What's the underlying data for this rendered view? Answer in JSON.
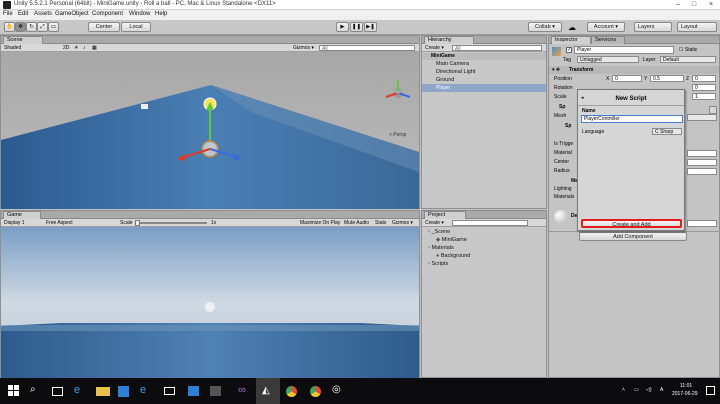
{
  "window": {
    "title": "Unity 5.5.2.1 Personal (64bit) - MiniGame.unity - Roll a ball - PC, Mac & Linux Standalone <DX11>"
  },
  "menu": [
    "File",
    "Edit",
    "Assets",
    "GameObject",
    "Component",
    "Window",
    "Help"
  ],
  "toolbar": {
    "center": "Center",
    "local": "Local",
    "collab": "Collab ▾",
    "account": "Account ▾",
    "layers": "Layers",
    "layout": "Layout"
  },
  "scene": {
    "tab": "Scene",
    "shading": "Shaded",
    "mode2d": "2D",
    "gizmos": "Gizmos ▾",
    "search": "All",
    "persp": "< Persp"
  },
  "game": {
    "tab": "Game",
    "display": "Display 1",
    "aspect": "Free Aspect",
    "scale_label": "Scale",
    "scale_value": "1x",
    "maximize": "Maximize On Play",
    "mute": "Mute Audio",
    "stats": "Stats",
    "gizmos": "Gizmos ▾"
  },
  "hierarchy": {
    "tab": "Hierarchy",
    "create": "Create ▾",
    "search": "All",
    "root": "MiniGame",
    "items": [
      "Main Camera",
      "Directional Light",
      "Ground",
      "Player"
    ]
  },
  "project": {
    "tab": "Project",
    "create": "Create ▾",
    "items": [
      {
        "label": "_Scene",
        "depth": 1
      },
      {
        "label": "MiniGame",
        "depth": 2
      },
      {
        "label": "Materials",
        "depth": 1
      },
      {
        "label": "Background",
        "depth": 2
      },
      {
        "label": "Scripts",
        "depth": 1
      }
    ]
  },
  "inspector": {
    "tab": "Inspector",
    "tab2": "Services",
    "name": "Player",
    "static": "Static",
    "tag_label": "Tag",
    "tag_value": "Untagged",
    "layer_label": "Layer",
    "layer_value": "Default",
    "transform": "Transform",
    "rows": [
      {
        "label": "Position",
        "x": "0",
        "y": "0.5",
        "z": "0"
      },
      {
        "label": "Rotation",
        "x": "",
        "y": "",
        "z": "0"
      },
      {
        "label": "Scale",
        "x": "",
        "y": "",
        "z": "1"
      }
    ],
    "partial": [
      "Sp",
      "Mesh",
      "Sp",
      "Is Trigge",
      "Material",
      "Center",
      "Radius",
      "Me",
      "Lighting",
      "Materials",
      "De"
    ],
    "add_component": "Add Component"
  },
  "new_script": {
    "title": "New Script",
    "name_label": "Name",
    "name_value": "PlayerController",
    "language_label": "Language",
    "language_value": "C Sharp",
    "create_button": "Create and Add"
  },
  "taskbar": {
    "time": "11:01",
    "date": "2017-06-29"
  }
}
